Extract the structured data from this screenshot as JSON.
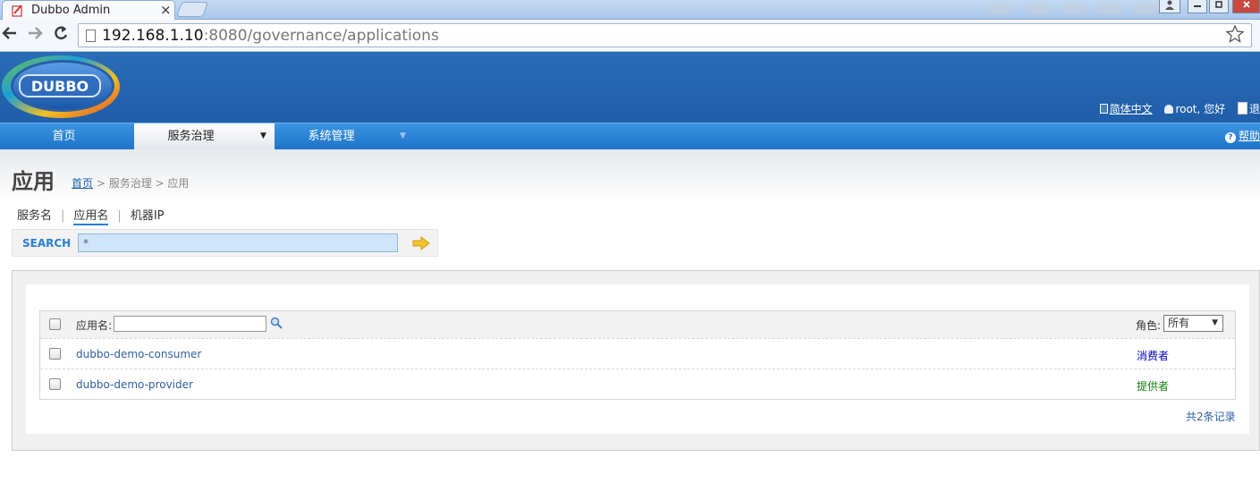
{
  "browser": {
    "tab_title": "Dubbo Admin",
    "tab_close": "×",
    "url_host": "192.168.1.10",
    "url_rest": ":8080/governance/applications",
    "back_icon": "arrow-left-icon",
    "forward_icon": "arrow-right-icon",
    "reload_icon": "reload-icon",
    "bookmark_icon": "star-icon"
  },
  "header": {
    "logo_text": "DUBBO",
    "lang_link": "简体中文",
    "user_greeting": "root, 您好",
    "logout_label": "退"
  },
  "nav": {
    "items": [
      {
        "label": "首页"
      },
      {
        "label": "服务治理",
        "caret": "▼"
      },
      {
        "label": "系统管理",
        "caret": "▼"
      }
    ],
    "help": "帮助"
  },
  "page": {
    "title": "应用",
    "breadcrumb_home": "首页",
    "breadcrumb_rest": " > 服务治理 > 应用"
  },
  "search": {
    "tabs": [
      "服务名",
      "应用名",
      "机器IP"
    ],
    "active_tab": "应用名",
    "label": "SEARCH",
    "value": "*"
  },
  "table": {
    "filter_label": "应用名:",
    "filter_value": "",
    "role_label": "角色:",
    "role_selected": "所有",
    "rows": [
      {
        "name": "dubbo-demo-consumer",
        "role": "消费者"
      },
      {
        "name": "dubbo-demo-provider",
        "role": "提供者"
      }
    ],
    "total": "共2条记录"
  },
  "colors": {
    "header_blue": "#1f5ea8",
    "nav_blue": "#1e74c9",
    "link_blue": "#2e5f9f",
    "consumer": "#0000c0",
    "provider": "#108010"
  }
}
